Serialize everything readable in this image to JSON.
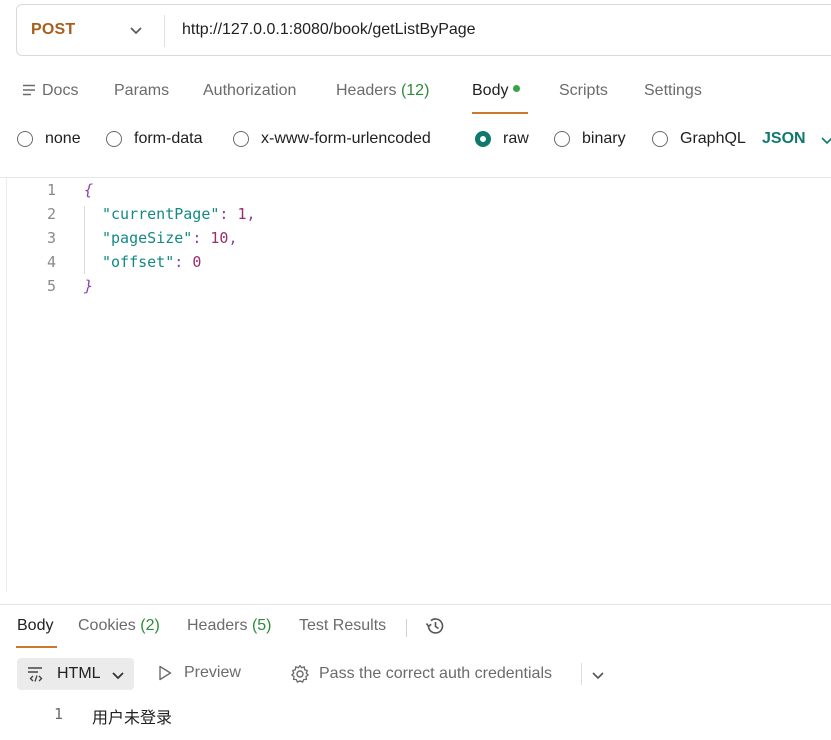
{
  "request": {
    "method": "POST",
    "url": "http://127.0.0.1:8080/book/getListByPage"
  },
  "request_tabs": [
    {
      "label": "Docs"
    },
    {
      "label": "Params"
    },
    {
      "label": "Authorization"
    },
    {
      "label": "Headers",
      "count": "(12)"
    },
    {
      "label": "Body",
      "active": true
    },
    {
      "label": "Scripts"
    },
    {
      "label": "Settings"
    }
  ],
  "body_types": [
    {
      "label": "none",
      "checked": false
    },
    {
      "label": "form-data",
      "checked": false
    },
    {
      "label": "x-www-form-urlencoded",
      "checked": false
    },
    {
      "label": "raw",
      "checked": true
    },
    {
      "label": "binary",
      "checked": false
    },
    {
      "label": "GraphQL",
      "checked": false
    }
  ],
  "raw_format": "JSON",
  "editor": {
    "line_numbers": [
      "1",
      "2",
      "3",
      "4",
      "5"
    ],
    "open_brace": "{",
    "close_brace": "}",
    "fields": [
      {
        "key": "\"currentPage\"",
        "value": "1",
        "comma": ","
      },
      {
        "key": "\"pageSize\"",
        "value": "10",
        "comma": ","
      },
      {
        "key": "\"offset\"",
        "value": "0",
        "comma": ""
      }
    ]
  },
  "response_tabs": [
    {
      "label": "Body",
      "active": true
    },
    {
      "label": "Cookies",
      "count": "(2)"
    },
    {
      "label": "Headers",
      "count": "(5)"
    },
    {
      "label": "Test Results"
    }
  ],
  "response_toolbar": {
    "format": "HTML",
    "preview": "Preview",
    "auth_hint": "Pass the correct auth credentials"
  },
  "response_body": {
    "line_number": "1",
    "text": "用户未登录"
  },
  "colors": {
    "method": "#a85e1a",
    "accent": "#0f7a6c",
    "active_underline": "#c97b2b",
    "count": "#2e8a3e"
  }
}
